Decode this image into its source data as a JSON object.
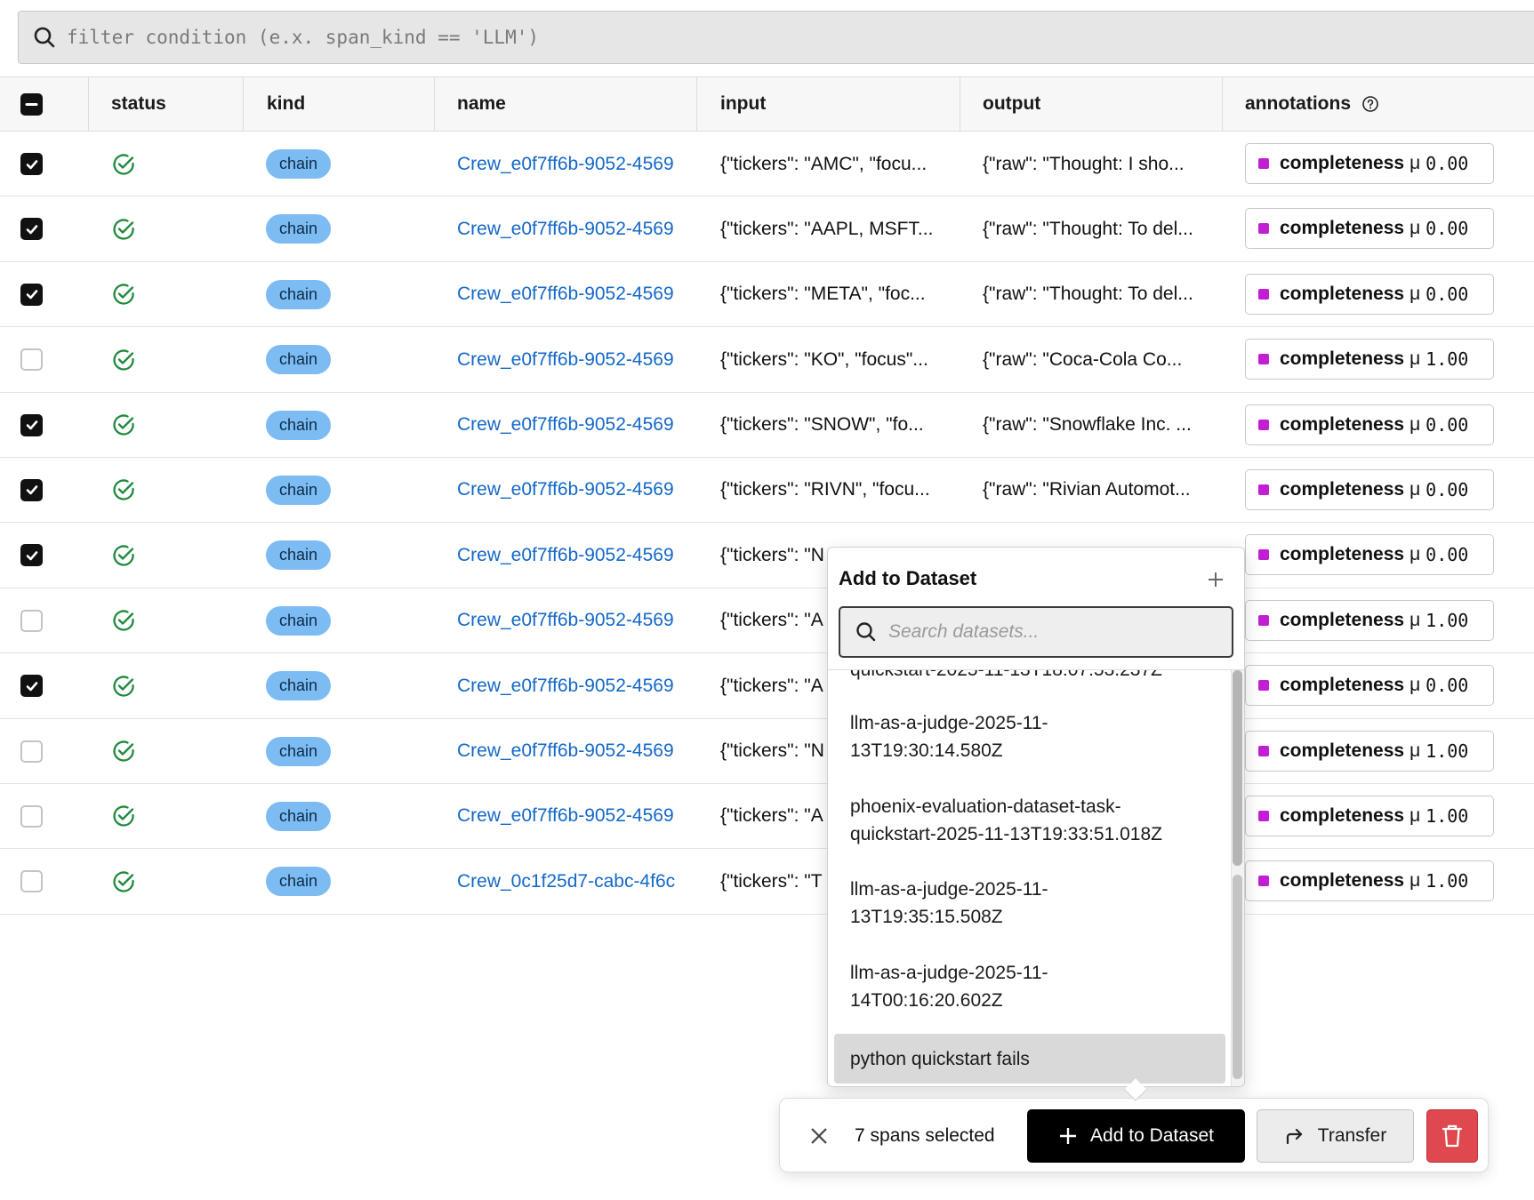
{
  "filter": {
    "placeholder": "filter condition (e.x. span_kind == 'LLM')"
  },
  "table": {
    "columns": [
      {
        "label": ""
      },
      {
        "label": "status"
      },
      {
        "label": "kind"
      },
      {
        "label": "name"
      },
      {
        "label": "input"
      },
      {
        "label": "output"
      },
      {
        "label": "annotations"
      }
    ],
    "rows": [
      {
        "checked": true,
        "status": "ok",
        "kind": "chain",
        "name": "Crew_e0f7ff6b-9052-4569",
        "input": "{\"tickers\": \"AMC\", \"focu...",
        "output": "{\"raw\": \"Thought: I sho...",
        "annotation_name": "completeness",
        "annotation_mu": "μ",
        "annotation_value": "0.00"
      },
      {
        "checked": true,
        "status": "ok",
        "kind": "chain",
        "name": "Crew_e0f7ff6b-9052-4569",
        "input": "{\"tickers\": \"AAPL, MSFT...",
        "output": "{\"raw\": \"Thought: To del...",
        "annotation_name": "completeness",
        "annotation_mu": "μ",
        "annotation_value": "0.00"
      },
      {
        "checked": true,
        "status": "ok",
        "kind": "chain",
        "name": "Crew_e0f7ff6b-9052-4569",
        "input": "{\"tickers\": \"META\", \"foc...",
        "output": "{\"raw\": \"Thought: To del...",
        "annotation_name": "completeness",
        "annotation_mu": "μ",
        "annotation_value": "0.00"
      },
      {
        "checked": false,
        "status": "ok",
        "kind": "chain",
        "name": "Crew_e0f7ff6b-9052-4569",
        "input": "{\"tickers\": \"KO\", \"focus\"...",
        "output": "{\"raw\": \"Coca-Cola Co...",
        "annotation_name": "completeness",
        "annotation_mu": "μ",
        "annotation_value": "1.00"
      },
      {
        "checked": true,
        "status": "ok",
        "kind": "chain",
        "name": "Crew_e0f7ff6b-9052-4569",
        "input": "{\"tickers\": \"SNOW\", \"fo...",
        "output": "{\"raw\": \"Snowflake Inc. ...",
        "annotation_name": "completeness",
        "annotation_mu": "μ",
        "annotation_value": "0.00"
      },
      {
        "checked": true,
        "status": "ok",
        "kind": "chain",
        "name": "Crew_e0f7ff6b-9052-4569",
        "input": "{\"tickers\": \"RIVN\", \"focu...",
        "output": "{\"raw\": \"Rivian Automot...",
        "annotation_name": "completeness",
        "annotation_mu": "μ",
        "annotation_value": "0.00"
      },
      {
        "checked": true,
        "status": "ok",
        "kind": "chain",
        "name": "Crew_e0f7ff6b-9052-4569",
        "input": "{\"tickers\": \"N",
        "output": "",
        "annotation_name": "completeness",
        "annotation_mu": "μ",
        "annotation_value": "0.00"
      },
      {
        "checked": false,
        "status": "ok",
        "kind": "chain",
        "name": "Crew_e0f7ff6b-9052-4569",
        "input": "{\"tickers\": \"A",
        "output": "",
        "annotation_name": "completeness",
        "annotation_mu": "μ",
        "annotation_value": "1.00"
      },
      {
        "checked": true,
        "status": "ok",
        "kind": "chain",
        "name": "Crew_e0f7ff6b-9052-4569",
        "input": "{\"tickers\": \"A",
        "output": "",
        "annotation_name": "completeness",
        "annotation_mu": "μ",
        "annotation_value": "0.00"
      },
      {
        "checked": false,
        "status": "ok",
        "kind": "chain",
        "name": "Crew_e0f7ff6b-9052-4569",
        "input": "{\"tickers\": \"N",
        "output": "",
        "annotation_name": "completeness",
        "annotation_mu": "μ",
        "annotation_value": "1.00"
      },
      {
        "checked": false,
        "status": "ok",
        "kind": "chain",
        "name": "Crew_e0f7ff6b-9052-4569",
        "input": "{\"tickers\": \"A",
        "output": "",
        "annotation_name": "completeness",
        "annotation_mu": "μ",
        "annotation_value": "1.00"
      },
      {
        "checked": false,
        "status": "ok",
        "kind": "chain",
        "name": "Crew_0c1f25d7-cabc-4f6c",
        "input": "{\"tickers\": \"T",
        "output": "",
        "annotation_name": "completeness",
        "annotation_mu": "μ",
        "annotation_value": "1.00"
      }
    ]
  },
  "popover": {
    "title": "Add to Dataset",
    "search_placeholder": "Search datasets...",
    "partial_item": "quickstart-2025-11-13T18:07:53.237Z",
    "items": [
      {
        "label": "llm-as-a-judge-2025-11-13T19:30:14.580Z",
        "line1": "llm-as-a-judge-2025-11-",
        "line2": "13T19:30:14.580Z",
        "selected": false
      },
      {
        "label": "phoenix-evaluation-dataset-task-quickstart-2025-11-13T19:33:51.018Z",
        "line1": "phoenix-evaluation-dataset-task-",
        "line2": "quickstart-2025-11-13T19:33:51.018Z",
        "selected": false
      },
      {
        "label": "llm-as-a-judge-2025-11-13T19:35:15.508Z",
        "line1": "llm-as-a-judge-2025-11-",
        "line2": "13T19:35:15.508Z",
        "selected": false
      },
      {
        "label": "llm-as-a-judge-2025-11-14T00:16:20.602Z",
        "line1": "llm-as-a-judge-2025-11-",
        "line2": "14T00:16:20.602Z",
        "selected": false
      },
      {
        "label": "python quickstart fails",
        "line1": "python quickstart fails",
        "line2": "",
        "selected": true
      }
    ]
  },
  "action_bar": {
    "count_text": "7 spans selected",
    "add_label": "Add to Dataset",
    "transfer_label": "Transfer"
  },
  "colors": {
    "status_ok": "#1e8a3c",
    "chip_bg": "#7cbcf2",
    "link": "#1468c8",
    "annotation_swatch": "#c21fd4",
    "delete": "#e0484f"
  },
  "icons": [
    "search-icon",
    "minus-icon",
    "check-icon",
    "check-circle-icon",
    "help-circle-icon",
    "plus-icon",
    "close-icon",
    "transfer-arrow-icon",
    "trash-icon"
  ]
}
